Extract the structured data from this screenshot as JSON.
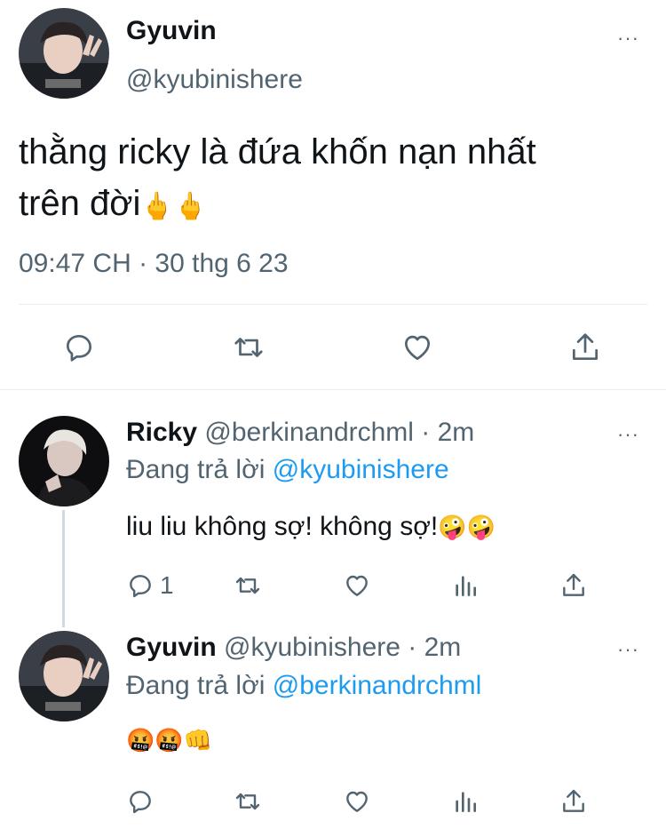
{
  "main_tweet": {
    "display_name": "Gyuvin",
    "handle": "@kyubinishere",
    "text_line1": "thằng ricky là đứa khốn nạn nhất",
    "text_line2": "trên đời",
    "emoji": "🖕🖕",
    "timestamp": "09:47 CH · 30 thg 6 23",
    "more_icon": "···"
  },
  "replies": [
    {
      "display_name": "Ricky",
      "handle": "@berkinandrchml",
      "time": "· 2m",
      "replying_prefix": "Đang trả lời",
      "replying_to": "@kyubinishere",
      "text": "liu liu không sợ! không sợ!",
      "emoji": "🤪🤪",
      "reply_count": "1"
    },
    {
      "display_name": "Gyuvin",
      "handle": "@kyubinishere",
      "time": "· 2m",
      "replying_prefix": "Đang trả lời",
      "replying_to": "@berkinandrchml",
      "text": "",
      "emoji": "🤬🤬👊",
      "reply_count": ""
    }
  ],
  "icons": {
    "reply": "reply-icon",
    "retweet": "retweet-icon",
    "like": "heart-icon",
    "share": "share-icon",
    "views": "views-icon",
    "more": "more-icon"
  },
  "colors": {
    "text": "#0f1419",
    "muted": "#536471",
    "link": "#1d9bf0",
    "divider": "#e6ecf0"
  }
}
